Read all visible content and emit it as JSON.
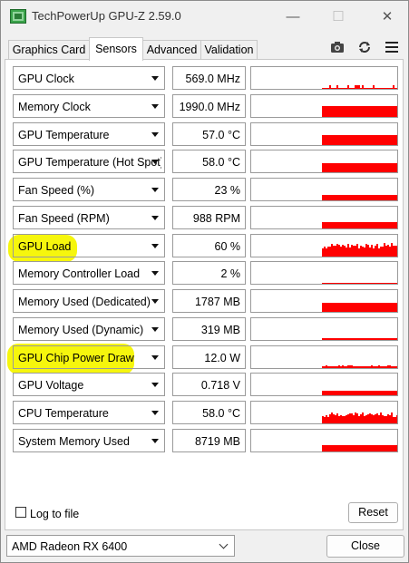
{
  "window": {
    "title": "TechPowerUp GPU-Z 2.59.0",
    "minimize_glyph": "—",
    "maximize_glyph": "☐",
    "close_glyph": "✕"
  },
  "tabs": [
    {
      "label": "Graphics Card",
      "active": false
    },
    {
      "label": "Sensors",
      "active": true
    },
    {
      "label": "Advanced",
      "active": false
    },
    {
      "label": "Validation",
      "active": false
    }
  ],
  "toolbar_icons": [
    "camera-icon",
    "refresh-icon",
    "menu-icon"
  ],
  "graph_color": "#ff0000",
  "highlight_color": "#f5f500",
  "sensors": [
    {
      "name": "GPU Clock",
      "value": "569.0 MHz",
      "level": 0.05,
      "pattern": "spiky",
      "highlighted": false
    },
    {
      "name": "Memory Clock",
      "value": "1990.0 MHz",
      "level": 0.5,
      "pattern": "solid",
      "highlighted": false
    },
    {
      "name": "GPU Temperature",
      "value": "57.0 °C",
      "level": 0.45,
      "pattern": "solid",
      "highlighted": false
    },
    {
      "name": "GPU Temperature (Hot Spot)",
      "value": "58.0 °C",
      "level": 0.4,
      "pattern": "solid",
      "highlighted": false
    },
    {
      "name": "Fan Speed (%)",
      "value": "23 %",
      "level": 0.25,
      "pattern": "solid",
      "highlighted": false
    },
    {
      "name": "Fan Speed (RPM)",
      "value": "988 RPM",
      "level": 0.3,
      "pattern": "solid",
      "highlighted": false
    },
    {
      "name": "GPU Load",
      "value": "60 %",
      "level": 0.6,
      "pattern": "noisy",
      "highlighted": true
    },
    {
      "name": "Memory Controller Load",
      "value": "2 %",
      "level": 0.02,
      "pattern": "solid",
      "highlighted": false
    },
    {
      "name": "Memory Used (Dedicated)",
      "value": "1787 MB",
      "level": 0.4,
      "pattern": "solid",
      "highlighted": false
    },
    {
      "name": "Memory Used (Dynamic)",
      "value": "319 MB",
      "level": 0.08,
      "pattern": "solid",
      "highlighted": false
    },
    {
      "name": "GPU Chip Power Draw",
      "value": "12.0 W",
      "level": 0.1,
      "pattern": "flat",
      "highlighted": true
    },
    {
      "name": "GPU Voltage",
      "value": "0.718 V",
      "level": 0.2,
      "pattern": "solid",
      "highlighted": false
    },
    {
      "name": "CPU Temperature",
      "value": "58.0 °C",
      "level": 0.45,
      "pattern": "noisy",
      "highlighted": false
    },
    {
      "name": "System Memory Used",
      "value": "8719 MB",
      "level": 0.3,
      "pattern": "solid",
      "highlighted": false
    }
  ],
  "footer": {
    "log_to_file_label": "Log to file",
    "log_to_file_checked": false,
    "reset_label": "Reset",
    "gpu_selected": "AMD Radeon RX 6400",
    "close_label": "Close"
  }
}
